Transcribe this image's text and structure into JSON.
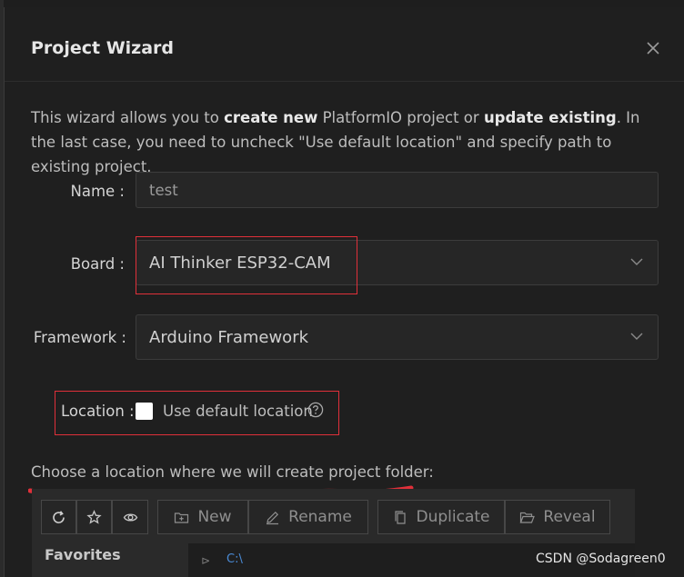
{
  "dialog": {
    "title": "Project Wizard",
    "intro": {
      "part1": "This wizard allows you to ",
      "bold1": "create new",
      "part2": " PlatformIO project or ",
      "bold2": "update existing",
      "part3": ". In the last case, you need to uncheck \"Use default location\" and specify path to existing project."
    },
    "name_label": "Name",
    "name_value": "test",
    "board_label": "Board",
    "board_value": "AI Thinker ESP32-CAM",
    "framework_label": "Framework",
    "framework_value": "Arduino Framework",
    "location_label": "Location",
    "use_default_location_label": "Use default location",
    "use_default_location_checked": false,
    "choose_text": "Choose a location where we will create project folder:",
    "folder_toolbar": {
      "new_label": "New",
      "rename_label": "Rename",
      "duplicate_label": "Duplicate",
      "reveal_label": "Reveal"
    },
    "favorites_label": "Favorites",
    "path_link": "C:\\"
  },
  "colors": {
    "highlight_red": "#e0303a",
    "background": "#1f1f1f",
    "link": "#4a8ad4"
  },
  "icons": [
    "close-icon",
    "chevron-down-icon",
    "help-circle-icon",
    "refresh-icon",
    "star-icon",
    "eye-icon",
    "new-folder-icon",
    "pencil-icon",
    "duplicate-icon",
    "folder-open-icon"
  ],
  "watermark": "CSDN @Sodagreen0"
}
